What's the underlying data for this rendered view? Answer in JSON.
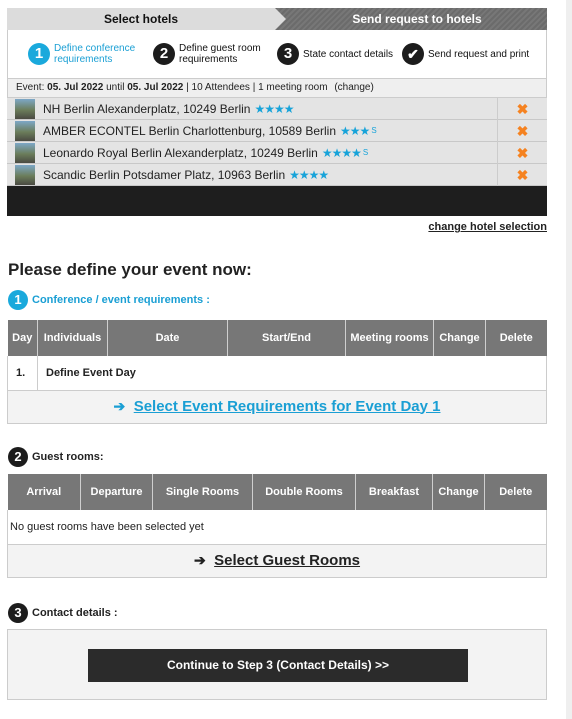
{
  "wizard": {
    "tabs": [
      {
        "label": "Select hotels"
      },
      {
        "label": "Send request to hotels"
      }
    ],
    "steps": [
      {
        "num": "1",
        "label": "Define conference requirements"
      },
      {
        "num": "2",
        "label": "Define guest room requirements"
      },
      {
        "num": "3",
        "label": "State contact details"
      },
      {
        "num": "✔",
        "label": "Send request and print"
      }
    ]
  },
  "event": {
    "prefix": "Event:",
    "start": "05. Jul 2022",
    "until": "until",
    "end": "05. Jul 2022",
    "details": "| 10 Attendees | 1 meeting room",
    "change": "(change)"
  },
  "hotels": [
    {
      "name": "NH Berlin Alexanderplatz, 10249 Berlin",
      "stars": "★★★★",
      "sup": "",
      "delete": "✖"
    },
    {
      "name": "AMBER ECONTEL Berlin Charlottenburg, 10589 Berlin",
      "stars": "★★★",
      "sup": "S",
      "delete": "✖"
    },
    {
      "name": "Leonardo Royal Berlin Alexanderplatz, 10249 Berlin",
      "stars": "★★★★",
      "sup": "S",
      "delete": "✖"
    },
    {
      "name": "Scandic Berlin Potsdamer Platz, 10963 Berlin",
      "stars": "★★★★",
      "sup": "",
      "delete": "✖"
    }
  ],
  "change_hotel_selection": "change hotel selection",
  "page_title": "Please define your event now:",
  "conference": {
    "num": "1",
    "heading": "Conference / event requirements :",
    "columns": [
      "Day",
      "Individuals",
      "Date",
      "Start/End",
      "Meeting rooms",
      "Change",
      "Delete"
    ],
    "row": {
      "day": "1.",
      "label": "Define Event Day"
    },
    "link": "Select Event Requirements for Event Day 1",
    "arrow": "➔"
  },
  "guest_rooms": {
    "num": "2",
    "heading": "Guest rooms:",
    "columns": [
      "Arrival",
      "Departure",
      "Single Rooms",
      "Double Rooms",
      "Breakfast",
      "Change",
      "Delete"
    ],
    "empty": "No guest rooms have been selected yet",
    "link": "Select Guest Rooms",
    "arrow": "➔"
  },
  "contact": {
    "num": "3",
    "heading": "Contact details :",
    "button": "Continue to Step 3 (Contact Details) >>"
  },
  "colors": {
    "accent": "#1aa9dc",
    "dark": "#1c1c1c",
    "delete": "#f58220",
    "header_gray": "#777777"
  }
}
